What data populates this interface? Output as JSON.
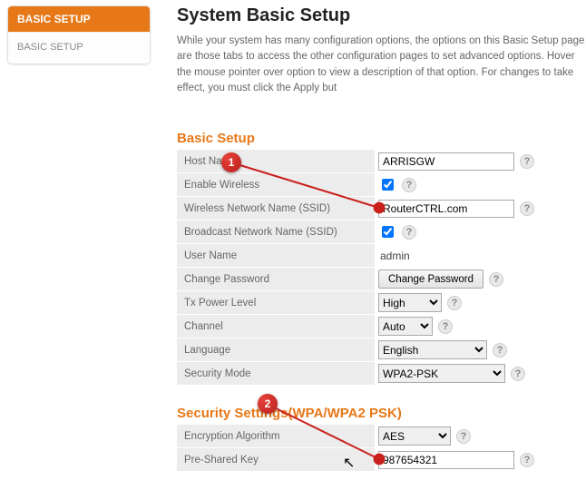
{
  "sidebar": {
    "active": "BASIC SETUP",
    "item": "BASIC SETUP"
  },
  "page": {
    "title": "System Basic Setup",
    "intro": "While your system has many configuration options, the options on this Basic Setup page are those tabs to access the other configuration pages to set advanced options. Hover the mouse pointer over option to view a description of that option. For changes to take effect, you must click the Apply but"
  },
  "sections": {
    "basic": "Basic Setup",
    "security": "Security Settings(WPA/WPA2 PSK)"
  },
  "form": {
    "host_name": {
      "label": "Host Name",
      "value": "ARRISGW"
    },
    "enable_wireless": {
      "label": "Enable Wireless",
      "checked": true
    },
    "ssid": {
      "label": "Wireless Network Name (SSID)",
      "value": "RouterCTRL.com"
    },
    "broadcast_ssid": {
      "label": "Broadcast Network Name (SSID)",
      "checked": true
    },
    "user_name": {
      "label": "User Name",
      "value": "admin"
    },
    "change_password": {
      "label": "Change Password",
      "button": "Change Password"
    },
    "tx_power": {
      "label": "Tx Power Level",
      "value": "High"
    },
    "channel": {
      "label": "Channel",
      "value": "Auto"
    },
    "language": {
      "label": "Language",
      "value": "English"
    },
    "security_mode": {
      "label": "Security Mode",
      "value": "WPA2-PSK"
    },
    "encryption": {
      "label": "Encryption Algorithm",
      "value": "AES"
    },
    "psk": {
      "label": "Pre-Shared Key",
      "value": "987654321"
    }
  },
  "help_glyph": "?",
  "callouts": {
    "one": "1",
    "two": "2"
  }
}
